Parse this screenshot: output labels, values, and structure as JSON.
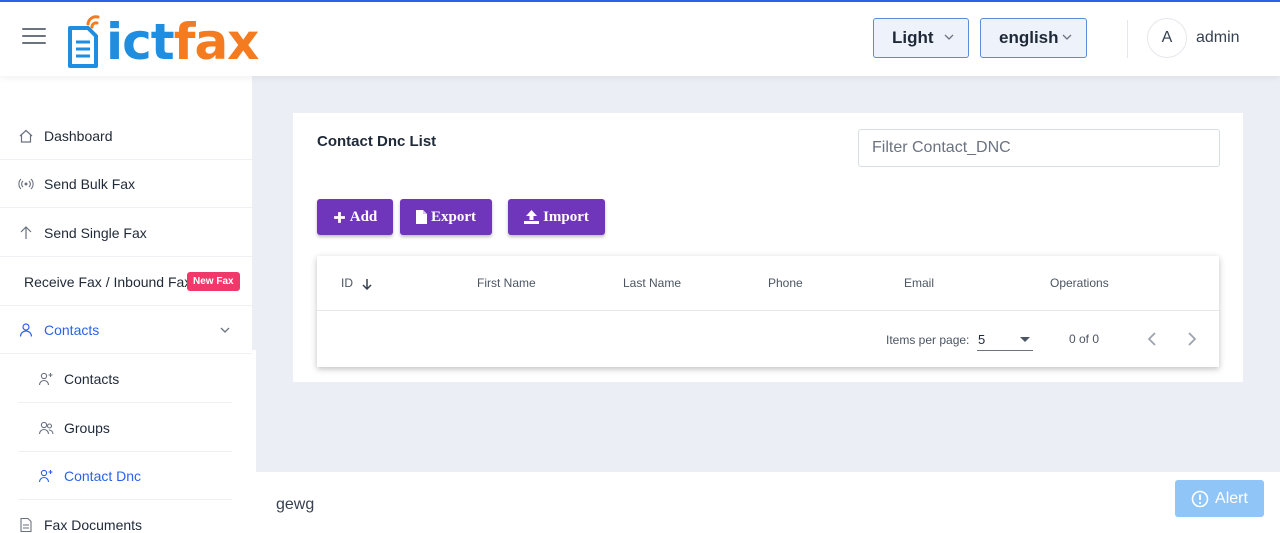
{
  "header": {
    "logo": {
      "part1": "ict",
      "part2": "fax"
    },
    "theme": {
      "selected": "Light"
    },
    "language": {
      "selected": "english"
    },
    "user": {
      "avatar_initial": "A",
      "name": "admin"
    }
  },
  "sidebar": {
    "items": [
      {
        "label": "Dashboard",
        "icon": "home-icon"
      },
      {
        "label": "Send Bulk Fax",
        "icon": "broadcast-icon"
      },
      {
        "label": "Send Single Fax",
        "icon": "arrow-up-icon"
      },
      {
        "label": "Receive Fax / Inbound Fax",
        "badge": "New Fax"
      },
      {
        "label": "Contacts",
        "icon": "user-icon",
        "expanded": true
      },
      {
        "label": "Contacts",
        "icon": "user-plus-icon"
      },
      {
        "label": "Groups",
        "icon": "users-icon"
      },
      {
        "label": "Contact Dnc",
        "icon": "user-plus-icon",
        "active": true
      },
      {
        "label": "Fax Documents",
        "icon": "document-icon"
      }
    ]
  },
  "main": {
    "title": "Contact Dnc List",
    "filter_placeholder": "Filter Contact_DNC",
    "buttons": {
      "add": "Add",
      "export": "Export",
      "import": "Import"
    },
    "table": {
      "columns": [
        "ID",
        "First Name",
        "Last Name",
        "Phone",
        "Email",
        "Operations"
      ],
      "rows": []
    },
    "paginator": {
      "items_per_page_label": "Items per page:",
      "page_size": "5",
      "range": "0 of 0"
    }
  },
  "footer": {
    "text": "gewg",
    "alert_label": "Alert"
  },
  "colors": {
    "accent": "#2a63e8",
    "button": "#6f36bb",
    "badge": "#f0386b",
    "alert": "#90c5f8"
  }
}
